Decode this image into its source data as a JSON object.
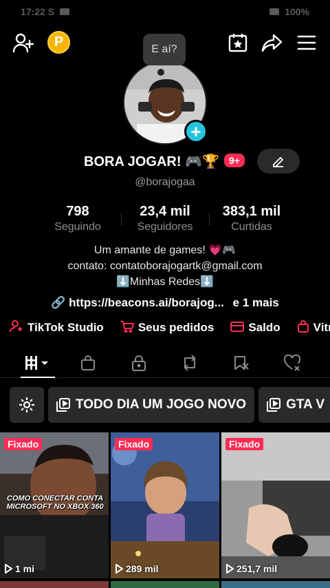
{
  "status_bar": {
    "time": "17:22 S",
    "battery": "100%"
  },
  "nav": {
    "add_friend_icon": "person-plus-icon",
    "coin_label": "P",
    "calendar_icon": "calendar-star-icon",
    "share_icon": "share-icon",
    "menu_icon": "hamburger-icon"
  },
  "profile": {
    "bubble_text": "E aí?",
    "display_name": "BORA JOGAR! 🎮🏆",
    "notification_badge": "9+",
    "username": "@borajogaa"
  },
  "stats": [
    {
      "value": "798",
      "label": "Seguindo"
    },
    {
      "value": "23,4 mil",
      "label": "Seguidores"
    },
    {
      "value": "383,1 mil",
      "label": "Curtidas"
    }
  ],
  "bio": {
    "line1": "Um amante de games! 💗🎮",
    "line2": "contato: contatoborajogartk@gmail.com",
    "line3": "⬇️Minhas Redes⬇️"
  },
  "link": {
    "url": "https://beacons.ai/borajog...",
    "extra": "e 1 mais"
  },
  "shortcuts": [
    {
      "label": "TikTok Studio",
      "icon": "person-star-icon"
    },
    {
      "label": "Seus pedidos",
      "icon": "cart-icon"
    },
    {
      "label": "Saldo",
      "icon": "wallet-icon"
    },
    {
      "label": "Vitr",
      "icon": "bag-icon"
    }
  ],
  "tabs": [
    {
      "name": "videos-grid",
      "icon": "grid-icon"
    },
    {
      "name": "shop",
      "icon": "bag-icon"
    },
    {
      "name": "private",
      "icon": "lock-icon"
    },
    {
      "name": "reposts",
      "icon": "repost-icon"
    },
    {
      "name": "favorites",
      "icon": "bookmark-icon"
    },
    {
      "name": "liked",
      "icon": "heart-hidden-icon"
    }
  ],
  "collections": [
    {
      "label": "TODO DIA UM JOGO NOVO"
    },
    {
      "label": "GTA V"
    }
  ],
  "videos": [
    {
      "pinned": "Fixado",
      "views": "1 mi",
      "overlay": "COMO CONECTAR CONTA MICROSOFT NO XBOX 360"
    },
    {
      "pinned": "Fixado",
      "views": "289 mil",
      "overlay": ""
    },
    {
      "pinned": "Fixado",
      "views": "251,7 mil",
      "overlay": ""
    }
  ]
}
